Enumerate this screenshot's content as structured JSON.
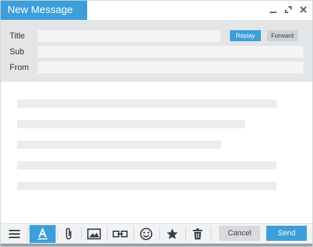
{
  "window": {
    "title": "New Message",
    "controls": [
      "minimize-icon",
      "maximize-icon",
      "close-icon"
    ]
  },
  "header": {
    "title_label": "Title",
    "sub_label": "Sub",
    "from_label": "From",
    "title_value": "",
    "sub_value": "",
    "from_value": "",
    "replay_label": "Replay",
    "forward_label": "Forward"
  },
  "toolbar": {
    "icons": [
      "menu-icon",
      "text-format-icon",
      "attach-icon",
      "image-icon",
      "link-icon",
      "emoji-icon",
      "star-icon",
      "trash-icon"
    ],
    "active_icon": "text-format-icon",
    "cancel_label": "Cancel",
    "send_label": "Send"
  },
  "colors": {
    "accent": "#3d9fd9",
    "header_bg": "#e3e5e7",
    "field_bg": "#f3f4f6",
    "icon": "#59636b"
  }
}
